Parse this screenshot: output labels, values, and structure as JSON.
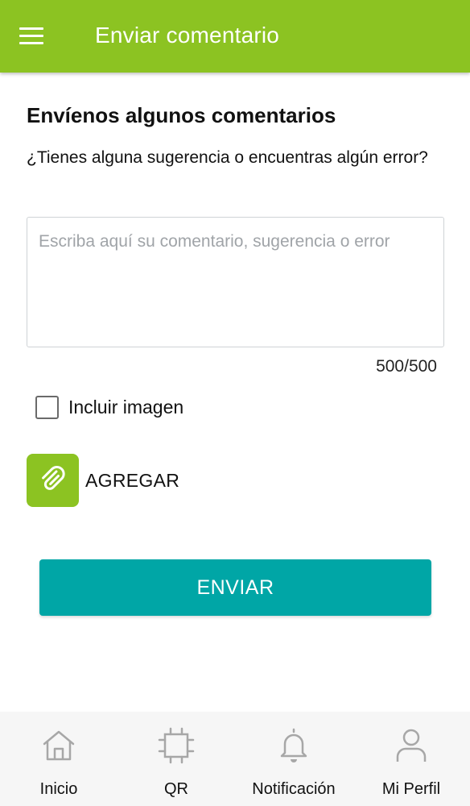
{
  "appbar": {
    "title": "Enviar comentario",
    "menu_icon": "hamburger-menu-icon",
    "color": "#8cc322"
  },
  "form": {
    "heading": "Envíenos algunos comentarios",
    "subtitle": "¿Tienes alguna sugerencia o encuentras algún error?",
    "comment_placeholder": "Escriba aquí su comentario, sugerencia o error",
    "comment_value": "",
    "counter": "500/500",
    "include_image_label": "Incluir imagen",
    "include_image_checked": false,
    "attach_label": "AGREGAR",
    "attach_icon": "paperclip-icon",
    "send_label": "ENVIAR",
    "send_color": "#00a6a6"
  },
  "bottom_nav": {
    "items": [
      {
        "label": "Inicio",
        "icon": "home-icon"
      },
      {
        "label": "QR",
        "icon": "qr-scan-icon"
      },
      {
        "label": "Notificación",
        "icon": "bell-icon"
      },
      {
        "label": "Mi Perfil",
        "icon": "user-icon"
      }
    ]
  }
}
